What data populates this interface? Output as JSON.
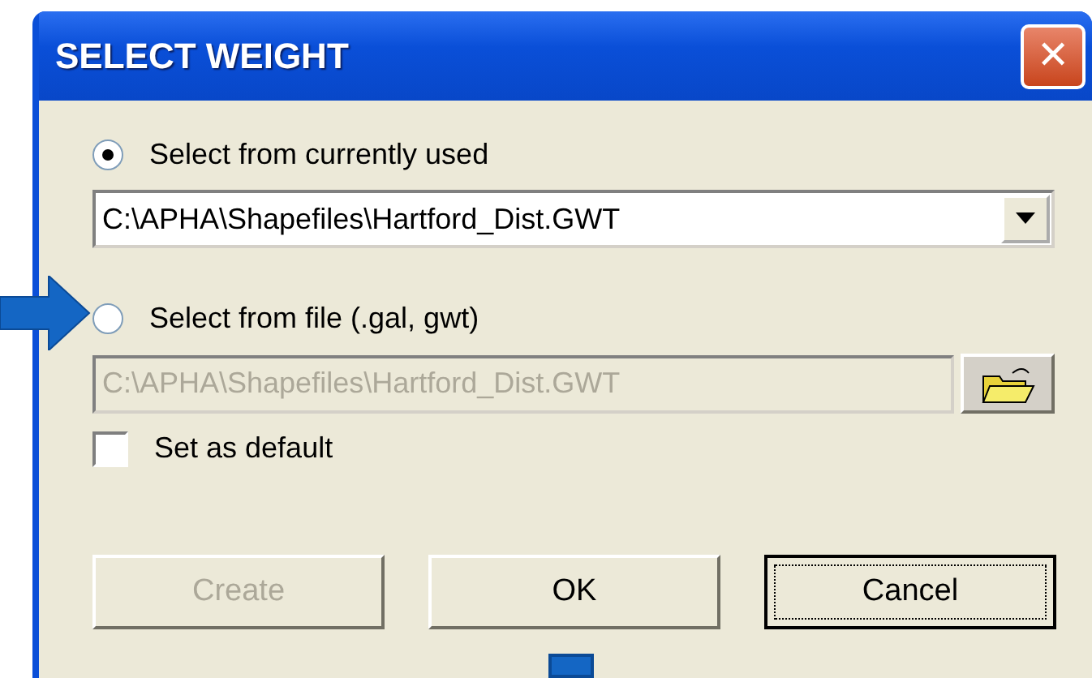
{
  "window": {
    "title": "SELECT WEIGHT",
    "close_label": "✕"
  },
  "options": [
    {
      "kind": "combo",
      "label": "Select from currently used",
      "selected": true,
      "value": "C:\\APHA\\Shapefiles\\Hartford_Dist.GWT",
      "disabled": false
    },
    {
      "kind": "file",
      "label": "Select from file (.gal, gwt)",
      "selected": false,
      "value": "C:\\APHA\\Shapefiles\\Hartford_Dist.GWT",
      "disabled": true
    }
  ],
  "default_checkbox": {
    "label": "Set as default",
    "checked": false
  },
  "buttons": [
    {
      "label": "Create",
      "disabled": true,
      "focused": false
    },
    {
      "label": "OK",
      "disabled": false,
      "focused": false
    },
    {
      "label": "Cancel",
      "disabled": false,
      "focused": true
    }
  ]
}
